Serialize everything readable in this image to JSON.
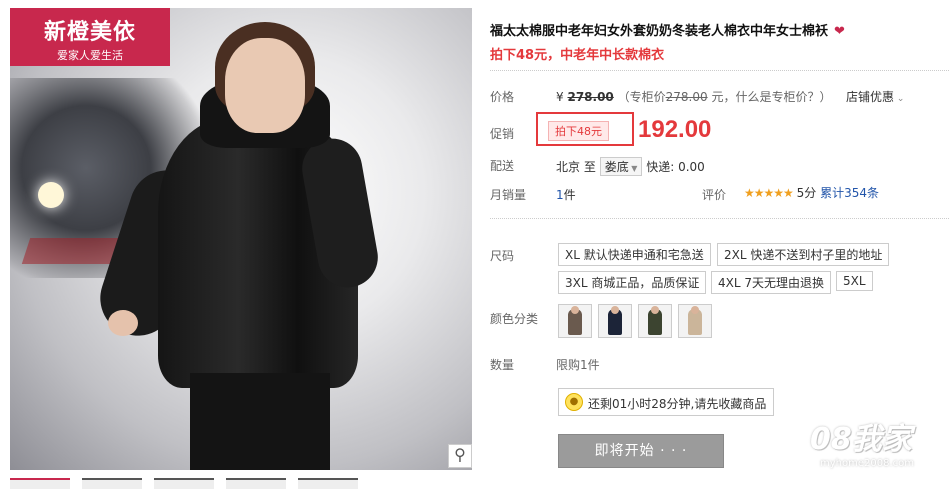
{
  "logo": {
    "brand": "新橙美依",
    "slogan": "爱家人爱生活"
  },
  "product": {
    "title": "福太太棉服中老年妇女外套奶奶冬装老人棉衣中年女士棉袄",
    "subtitle": "拍下48元，中老年中长款棉衣"
  },
  "price": {
    "label": "价格",
    "currency": "¥",
    "original": "278.00",
    "counter_prefix": "（专柜价",
    "counter_value": "278.00",
    "counter_suffix": "元，什么是专柜价？）",
    "shop_discount": "店铺优惠"
  },
  "promo": {
    "label": "促销",
    "tag": "拍下48元",
    "price": "192.00"
  },
  "shipping": {
    "label": "配送",
    "from": "北京",
    "to_word": "至",
    "destination": "娄底",
    "express": "快递: 0.00"
  },
  "sales": {
    "label": "月销量",
    "count": "1",
    "unit": "件",
    "rating_label": "评价",
    "stars": "★★★★★",
    "score": "5分",
    "reviews": "累计354条"
  },
  "sizes": {
    "label": "尺码",
    "options": [
      "XL 默认快递申通和宅急送",
      "2XL 快递不送到村子里的地址",
      "3XL 商城正品，品质保证",
      "4XL 7天无理由退换",
      "5XL"
    ]
  },
  "colors": {
    "label": "颜色分类",
    "swatches": [
      "#6a5a4e",
      "#1c2438",
      "#3c4430",
      "#cbb59a"
    ]
  },
  "quantity": {
    "label": "数量",
    "limit": "限购1件"
  },
  "notice": {
    "icon": "lightbulb-icon",
    "text": "还剩01小时28分钟,请先收藏商品"
  },
  "buy_button": {
    "label": "即将开始 · · ·"
  },
  "watermark": {
    "brand": "08我家",
    "url": "myhome2008.com"
  },
  "zoom_icon": "magnifier-icon"
}
